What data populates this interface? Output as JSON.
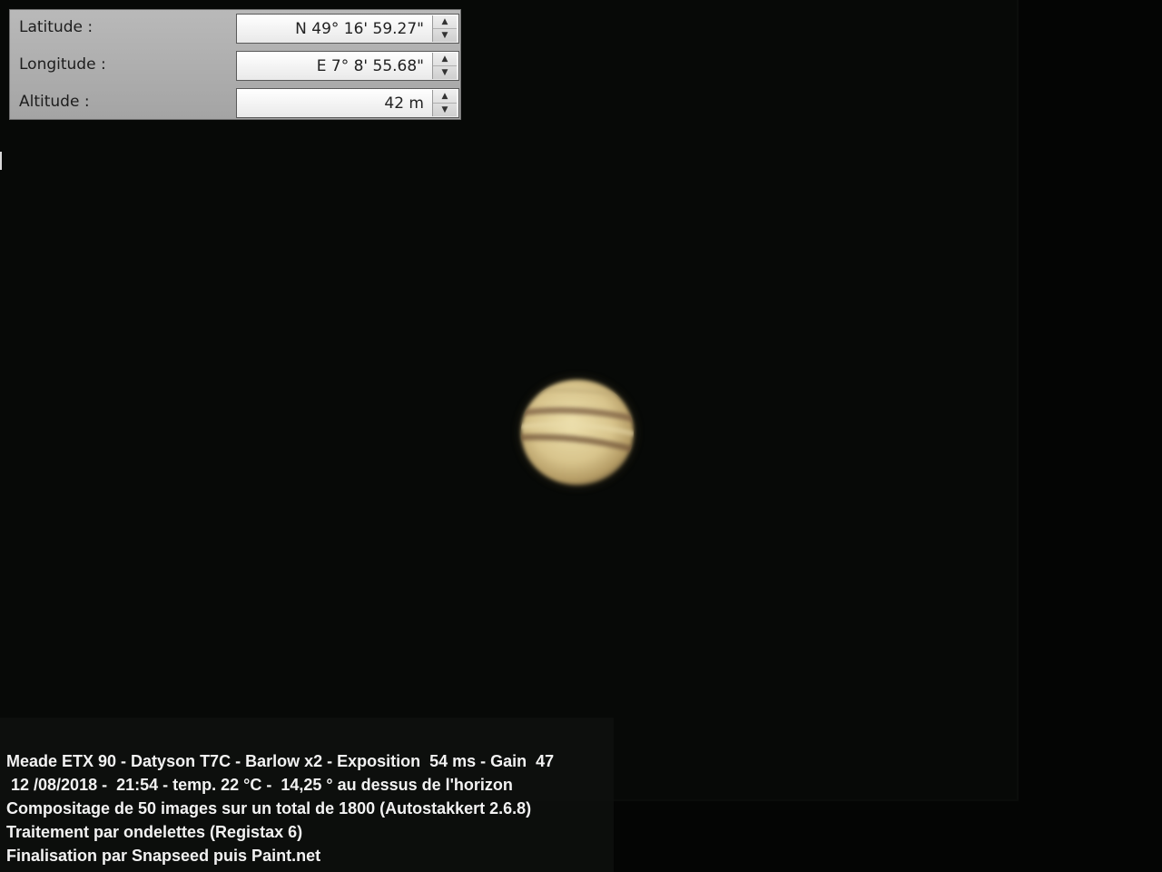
{
  "coordinates": {
    "latitude": {
      "label": "Latitude :",
      "value": "N 49° 16' 59.27\""
    },
    "longitude": {
      "label": "Longitude :",
      "value": "E 7° 8' 55.68\""
    },
    "altitude": {
      "label": "Altitude :",
      "value": "42 m"
    }
  },
  "caption": {
    "line1": "Meade ETX 90 - Datyson T7C - Barlow x2 - Exposition  54 ms - Gain  47",
    "line2": " 12 /08/2018 -  21:54 - temp. 22 °C -  14,25 ° au dessus de l'horizon",
    "line3": "Compositage de 50 images sur un total de 1800 (Autostakkert 2.6.8)",
    "line4": "Traitement par ondelettes (Registax 6)",
    "line5": "Finalisation par Snapseed puis Paint.net"
  },
  "colors": {
    "background": "#040504",
    "planet_light": "#e6d7a2",
    "planet_mid": "#c9b27a",
    "belt": "#7a5a3e"
  }
}
